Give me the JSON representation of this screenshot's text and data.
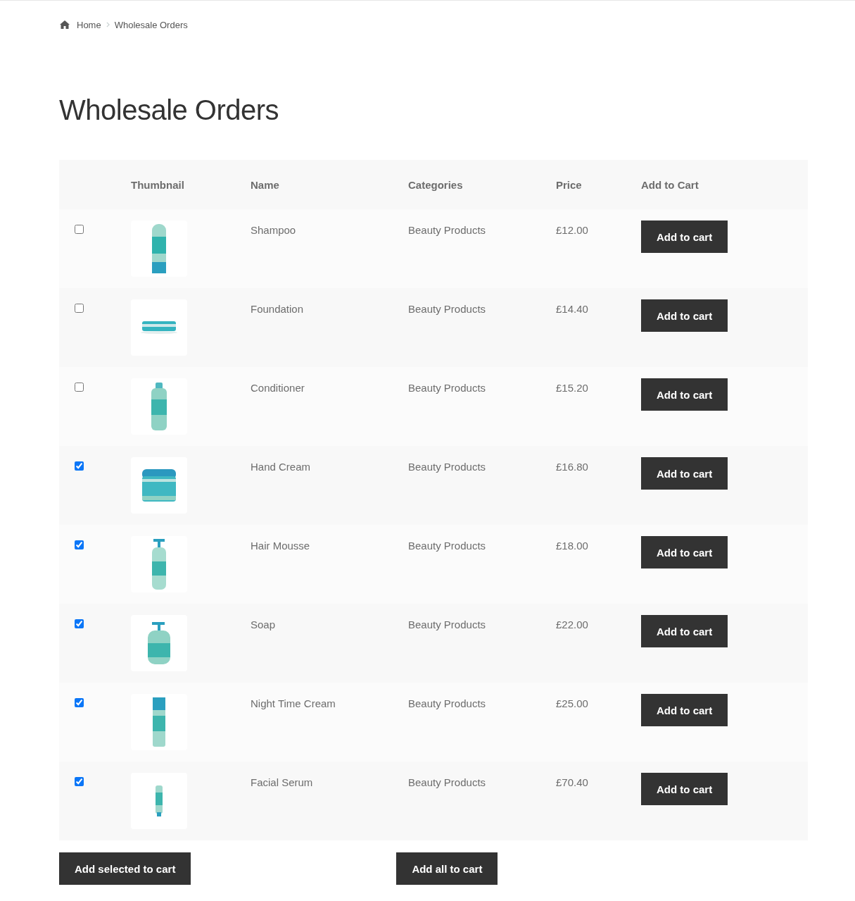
{
  "breadcrumb": [
    "Home",
    "Wholesale Orders"
  ],
  "title": "Wholesale Orders",
  "table": {
    "columns": [
      "Thumbnail",
      "Name",
      "Categories",
      "Price",
      "Add to Cart"
    ],
    "rows": [
      {
        "checked": false,
        "name": "Shampoo",
        "category": "Beauty Products",
        "price": "£12.00",
        "button": "Add to cart"
      },
      {
        "checked": false,
        "name": "Foundation",
        "category": "Beauty Products",
        "price": "£14.40",
        "button": "Add to cart"
      },
      {
        "checked": false,
        "name": "Conditioner",
        "category": "Beauty Products",
        "price": "£15.20",
        "button": "Add to cart"
      },
      {
        "checked": true,
        "name": "Hand Cream",
        "category": "Beauty Products",
        "price": "£16.80",
        "button": "Add to cart"
      },
      {
        "checked": true,
        "name": "Hair Mousse",
        "category": "Beauty Products",
        "price": "£18.00",
        "button": "Add to cart"
      },
      {
        "checked": true,
        "name": "Soap",
        "category": "Beauty Products",
        "price": "£22.00",
        "button": "Add to cart"
      },
      {
        "checked": true,
        "name": "Night Time Cream",
        "category": "Beauty Products",
        "price": "£25.00",
        "button": "Add to cart"
      },
      {
        "checked": true,
        "name": "Facial Serum",
        "category": "Beauty Products",
        "price": "£70.40",
        "button": "Add to cart"
      }
    ]
  },
  "actions": [
    "Add selected to cart",
    "Add all to cart"
  ]
}
